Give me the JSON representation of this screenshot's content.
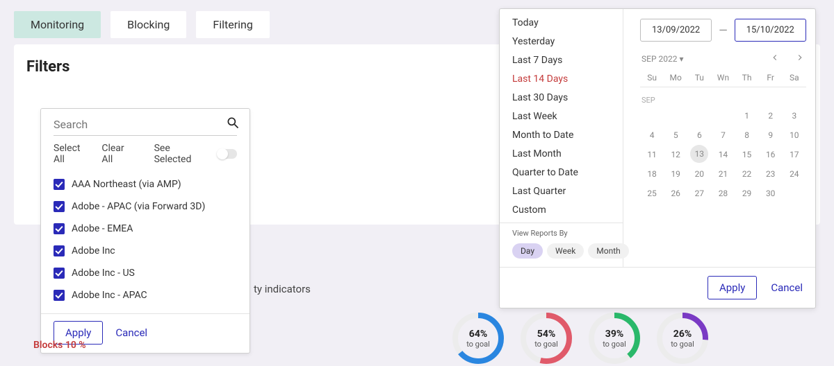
{
  "tabs": {
    "monitoring": "Monitoring",
    "blocking": "Blocking",
    "filtering": "Filtering"
  },
  "main": {
    "title": "Filters",
    "indicator_text": "ty indicators"
  },
  "filter_popover": {
    "search_placeholder": "Search",
    "select_all": "Select All",
    "clear_all": "Clear All",
    "see_selected": "See Selected",
    "items": [
      "AAA Northeast (via AMP)",
      "Adobe - APAC (via Forward 3D)",
      "Adobe - EMEA",
      "Adobe Inc",
      "Adobe Inc -  US",
      "Adobe Inc -  APAC"
    ],
    "apply": "Apply",
    "cancel": "Cancel"
  },
  "blocks": "Blocks 10 %",
  "goals": [
    {
      "pct": "64%",
      "sub": "to goal",
      "color": "#2a86e0"
    },
    {
      "pct": "54%",
      "sub": "to goal",
      "color": "#e05a6a"
    },
    {
      "pct": "39%",
      "sub": "to goal",
      "color": "#2ab86a"
    },
    {
      "pct": "26%",
      "sub": "to goal",
      "color": "#7a3ac4"
    }
  ],
  "date_panel": {
    "presets": [
      "Today",
      "Yesterday",
      "Last 7 Days",
      "Last 14 Days",
      "Last 30 Days",
      "Last Week",
      "Month to Date",
      "Last Month",
      "Quarter to Date",
      "Last Quarter",
      "Custom"
    ],
    "selected_preset": "Last 14 Days",
    "view_by_label": "View Reports By",
    "view_by": [
      "Day",
      "Week",
      "Month"
    ],
    "view_by_active": "Day",
    "start": "13/09/2022",
    "end": "15/10/2022",
    "month_label": "SEP 2022",
    "dow": [
      "Su",
      "Mo",
      "Tu",
      "Wn",
      "Th",
      "Fr",
      "Sa"
    ],
    "week_label": "SEP",
    "weeks": [
      [
        "",
        "",
        "",
        "",
        "1",
        "2",
        "3"
      ],
      [
        "4",
        "5",
        "6",
        "7",
        "8",
        "9",
        "10"
      ],
      [
        "11",
        "12",
        "13",
        "14",
        "15",
        "16",
        "17"
      ],
      [
        "18",
        "19",
        "20",
        "21",
        "22",
        "23",
        "24"
      ],
      [
        "25",
        "26",
        "27",
        "28",
        "29",
        "30",
        ""
      ]
    ],
    "today": "13",
    "apply": "Apply",
    "cancel": "Cancel"
  }
}
